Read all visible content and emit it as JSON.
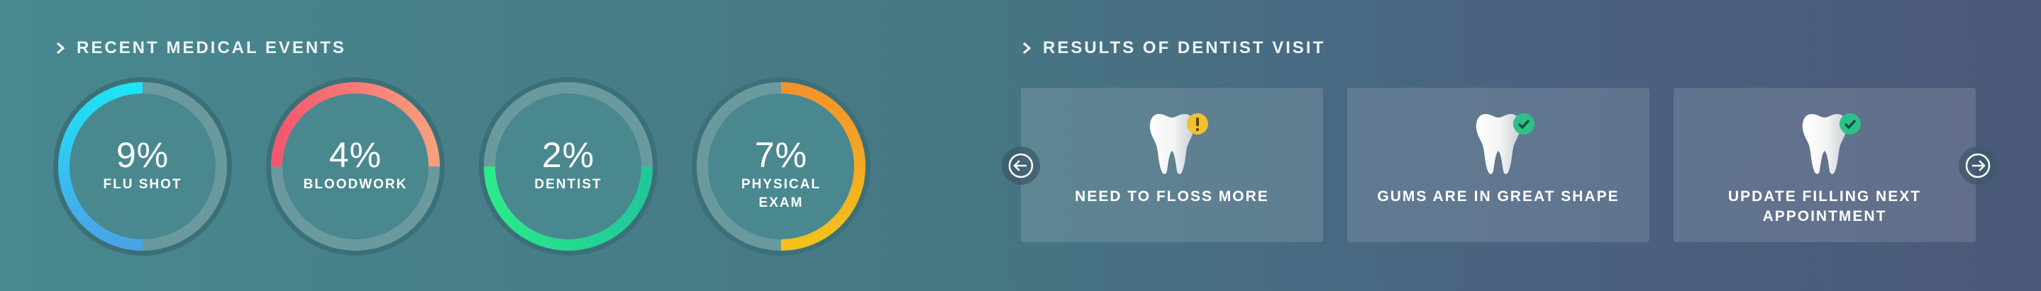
{
  "left_section": {
    "title": "RECENT MEDICAL EVENTS",
    "events": [
      {
        "percent_label": "9%",
        "label": "FLU SHOT",
        "fraction": 0.5,
        "gradient": [
          "#1ee4f6",
          "#4aa3e8"
        ],
        "direction": "ccw-from-top"
      },
      {
        "percent_label": "4%",
        "label": "BLOODWORK",
        "fraction": 0.5,
        "gradient": [
          "#f4566f",
          "#f7a07e"
        ],
        "direction": "top-half"
      },
      {
        "percent_label": "2%",
        "label": "DENTIST",
        "fraction": 0.5,
        "gradient": [
          "#2cea8a",
          "#20c79a"
        ],
        "direction": "bottom-half"
      },
      {
        "percent_label": "7%",
        "label": "PHYSICAL EXAM",
        "fraction": 0.5,
        "gradient": [
          "#f4922a",
          "#f3c21a"
        ],
        "direction": "cw-from-top"
      }
    ]
  },
  "right_section": {
    "title": "RESULTS OF DENTIST VISIT",
    "cards": [
      {
        "text": "NEED TO FLOSS MORE",
        "status_icon": "warning-icon",
        "status_color": "#f2c12e"
      },
      {
        "text": "GUMS ARE IN GREAT SHAPE",
        "status_icon": "check-icon",
        "status_color": "#2bc28a"
      },
      {
        "text": "UPDATE FILLING NEXT APPOINTMENT",
        "status_icon": "check-icon",
        "status_color": "#2bc28a"
      }
    ],
    "prev_icon": "arrow-left-icon",
    "next_icon": "arrow-right-icon"
  },
  "colors": {
    "ring_track": "#6b9a9e",
    "ring_outer": "#3c7078"
  }
}
